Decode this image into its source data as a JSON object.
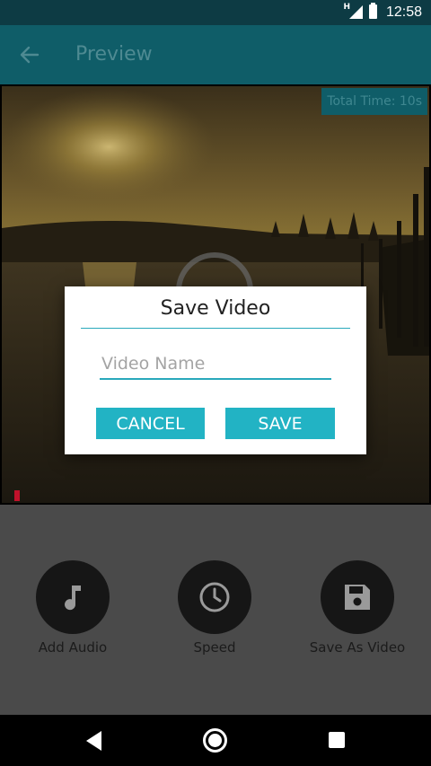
{
  "status_bar": {
    "time": "12:58",
    "network_type": "H",
    "icons": [
      "signal-icon",
      "battery-icon"
    ]
  },
  "app_bar": {
    "title": "Preview",
    "back_icon": "arrow-left-icon"
  },
  "video": {
    "total_time": "Total Time: 10s",
    "play_icon": "play-circle-icon"
  },
  "actions": [
    {
      "label": "Add Audio",
      "icon": "music-note-icon"
    },
    {
      "label": "Speed",
      "icon": "clock-icon"
    },
    {
      "label": "Save As Video",
      "icon": "save-disk-icon"
    }
  ],
  "dialog": {
    "title": "Save Video",
    "input_placeholder": "Video Name",
    "input_value": "",
    "cancel_label": "CANCEL",
    "save_label": "SAVE"
  },
  "nav_bar": {
    "icons": [
      "nav-back-icon",
      "nav-home-icon",
      "nav-recents-icon"
    ]
  },
  "colors": {
    "accent": "#22b3c4",
    "app_bar": "#0f5d68",
    "status_bar": "#0d3b44",
    "panel": "#4a4a4a",
    "progress": "#c0112b"
  }
}
